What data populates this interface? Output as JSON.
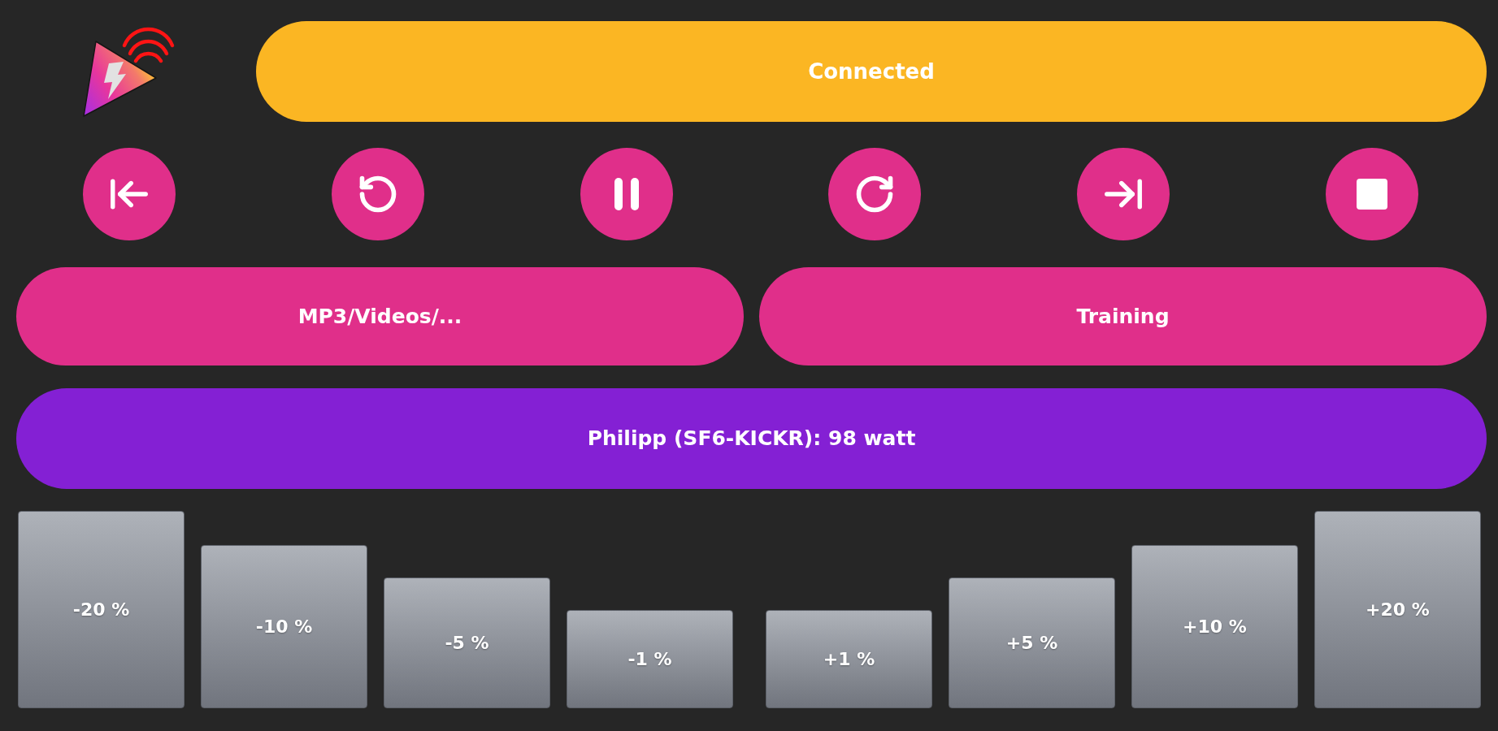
{
  "status_bar": {
    "text": "Connected"
  },
  "media_buttons": [
    {
      "label": "MP3/Videos/..."
    },
    {
      "label": "Training"
    }
  ],
  "power_bar": {
    "text": "Philipp (SF6-KICKR): 98 watt"
  },
  "adjust_buttons": [
    {
      "label": "-20 %"
    },
    {
      "label": "-10 %"
    },
    {
      "label": "-5 %"
    },
    {
      "label": "-1 %"
    },
    {
      "label": "+1 %"
    },
    {
      "label": "+5 %"
    },
    {
      "label": "+10 %"
    },
    {
      "label": "+20 %"
    }
  ]
}
